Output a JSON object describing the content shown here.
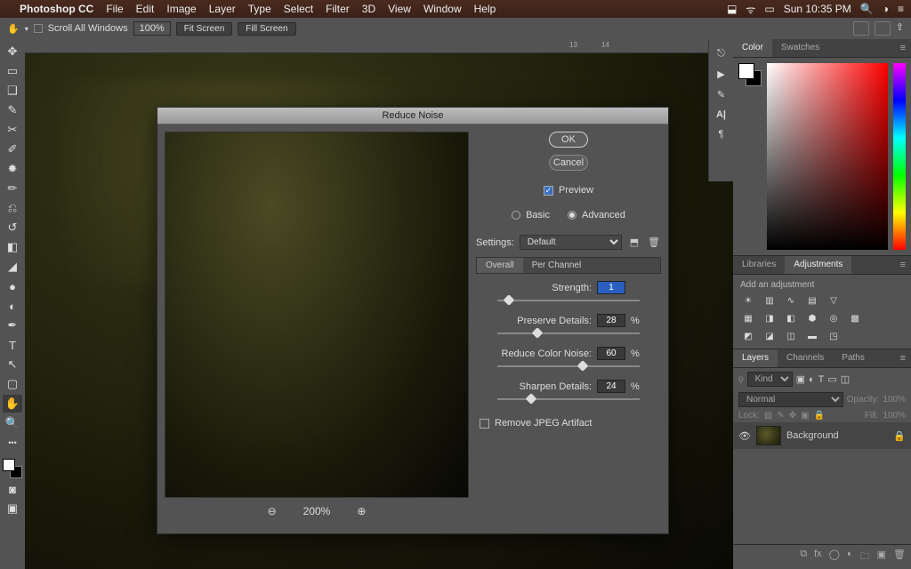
{
  "menubar": {
    "app": "Photoshop CC",
    "items": [
      "File",
      "Edit",
      "Image",
      "Layer",
      "Type",
      "Select",
      "Filter",
      "3D",
      "View",
      "Window",
      "Help"
    ],
    "clock": "Sun 10:35 PM"
  },
  "options": {
    "scroll_all": "Scroll All Windows",
    "zoom": "100%",
    "fit": "Fit Screen",
    "fill": "Fill Screen"
  },
  "ruler": {
    "marks": [
      {
        "pos": 640,
        "label": "13"
      },
      {
        "pos": 676,
        "label": "14"
      }
    ]
  },
  "dialog": {
    "title": "Reduce Noise",
    "ok": "OK",
    "cancel": "Cancel",
    "preview": "Preview",
    "basic": "Basic",
    "advanced": "Advanced",
    "settings_label": "Settings:",
    "settings_value": "Default",
    "tabs": {
      "overall": "Overall",
      "per_channel": "Per Channel"
    },
    "sliders": {
      "strength": {
        "label": "Strength:",
        "value": "1",
        "pct": 8,
        "unit": ""
      },
      "preserve": {
        "label": "Preserve Details:",
        "value": "28",
        "pct": 28,
        "unit": "%"
      },
      "color_noise": {
        "label": "Reduce Color Noise:",
        "value": "60",
        "pct": 60,
        "unit": "%"
      },
      "sharpen": {
        "label": "Sharpen Details:",
        "value": "24",
        "pct": 24,
        "unit": "%"
      }
    },
    "remove_jpeg": "Remove JPEG Artifact",
    "preview_zoom": "200%"
  },
  "panels": {
    "color": {
      "tab_color": "Color",
      "tab_swatches": "Swatches"
    },
    "libs": {
      "tab_libraries": "Libraries",
      "tab_adjustments": "Adjustments",
      "hint": "Add an adjustment"
    },
    "layers": {
      "tab_layers": "Layers",
      "tab_channels": "Channels",
      "tab_paths": "Paths",
      "kind": "Kind",
      "blend": "Normal",
      "opacity_label": "Opacity:",
      "opacity": "100%",
      "lock_label": "Lock:",
      "fill_label": "Fill:",
      "fill": "100%",
      "layer_name": "Background"
    }
  }
}
